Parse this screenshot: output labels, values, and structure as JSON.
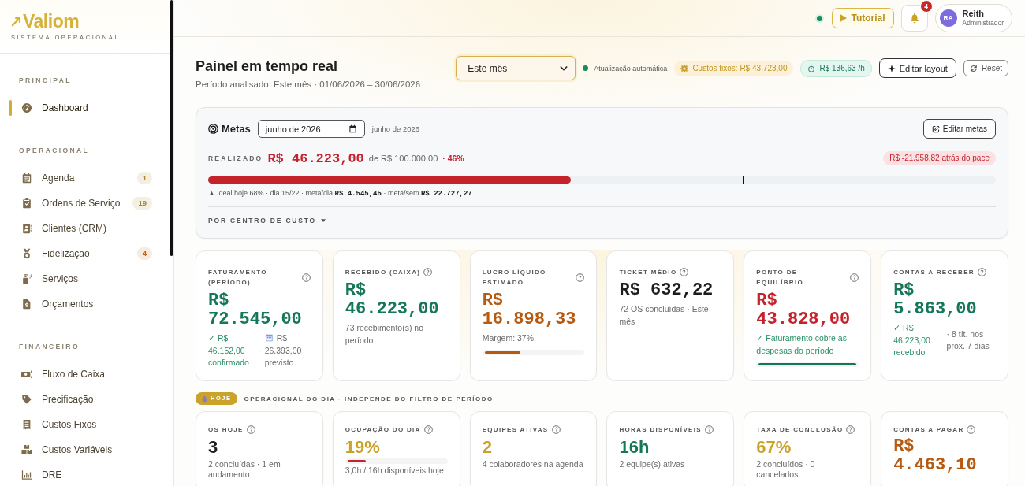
{
  "sidebar": {
    "logo": {
      "name": "Valiom",
      "tagline": "SISTEMA OPERACIONAL"
    },
    "sections": [
      {
        "title": "PRINCIPAL",
        "items": [
          {
            "label": "Dashboard",
            "selected": true
          }
        ]
      },
      {
        "title": "OPERACIONAL",
        "items": [
          {
            "label": "Agenda",
            "selected": false,
            "badge": {
              "text": "1",
              "color": "#a8842a"
            }
          },
          {
            "label": "Ordens de Serviço",
            "selected": false,
            "badge": {
              "text": "19",
              "color": "#a8842a"
            }
          },
          {
            "label": "Clientes (CRM)",
            "selected": false
          },
          {
            "label": "Fidelização",
            "selected": false,
            "badge": {
              "text": "4",
              "color": "#c0621a"
            }
          },
          {
            "label": "Serviços",
            "selected": false
          },
          {
            "label": "Orçamentos",
            "selected": false
          }
        ]
      },
      {
        "title": "FINANCEIRO",
        "items": [
          {
            "label": "Fluxo de Caixa",
            "selected": false
          },
          {
            "label": "Precificação",
            "selected": false
          },
          {
            "label": "Custos Fixos",
            "selected": false
          },
          {
            "label": "Custos Variáveis",
            "selected": false
          },
          {
            "label": "DRE",
            "selected": false
          }
        ]
      }
    ]
  },
  "topbar": {
    "online": true,
    "tutorial_button": "Tutorial",
    "notifications": {
      "count": "4"
    },
    "user": {
      "initials": "RA",
      "name": "Reith",
      "role": "Administrador"
    }
  },
  "header": {
    "title": "Painel em tempo real",
    "subtitle": "Período analisado: Este mês · 01/06/2026 – 30/06/2026",
    "period_select": {
      "value": "Este mês"
    },
    "auto_update": {
      "label": "Atualização automática",
      "on": true
    },
    "chips": [
      {
        "text": "Custos fixos: R$ 43.723,00",
        "kind": "fixed_costs"
      },
      {
        "text": "R$ 136,63 /h",
        "kind": "hourly_rate"
      }
    ],
    "buttons": [
      {
        "label": "Editar layout",
        "kind": "edit_layout"
      },
      {
        "label": "Reset",
        "kind": "reset"
      }
    ]
  },
  "metas": {
    "title": "Metas",
    "month_field": {
      "value": "junho de 2026"
    },
    "month_label": "junho de 2026",
    "edit_button": "Editar metas",
    "realized_label": "REALIZADO",
    "realized_value": "R$ 46.223,00",
    "target": "de R$ 100.000,00",
    "percent": "· 46%",
    "pace_badge": "R$ -21.958,82 atrás do pace",
    "progress": {
      "level": 0.46
    },
    "pace_marker": {
      "level": 0.68
    },
    "note": "▲ ideal hoje 68% · dia 15/22 · meta/dia **R$ 4.545,45** · meta/sem **R$ 22.727,27**",
    "cost_center_toggle": {
      "label": "POR CENTRO DE CUSTO",
      "expanded": false
    }
  },
  "kpis": [
    {
      "label": "FATURAMENTO (PERÍODO)",
      "value": "R$ 72.545,00",
      "kind": "money",
      "color": "#16765a",
      "details": [
        {
          "kind": "split",
          "parts": [
            {
              "text": "✓ R$ 46.152,00 confirmado",
              "kind": "text",
              "color": "#2a8f66"
            },
            {
              "text": "·",
              "kind": "separator"
            },
            {
              "text": "R$ 26.393,00 previsto",
              "kind": "forecast",
              "color": "#6b6b6b"
            }
          ]
        }
      ]
    },
    {
      "label": "RECEBIDO (CAIXA)",
      "value": "R$ 46.223,00",
      "kind": "money",
      "color": "#16765a",
      "details": [
        {
          "kind": "note",
          "text": "73 recebimento(s) no período",
          "color": "#6b6b6b"
        }
      ]
    },
    {
      "label": "LUCRO LÍQUIDO ESTIMADO",
      "value": "R$ 16.898,33",
      "kind": "money",
      "color": "#b65a12",
      "details": [
        {
          "kind": "note",
          "text": "Margem: 37%",
          "color": "#6b6b6b"
        },
        {
          "kind": "bar",
          "level": 0.37,
          "color": "#b65a12"
        }
      ]
    },
    {
      "label": "TICKET MÉDIO",
      "value": "R$ 632,22",
      "kind": "money",
      "color": "#1d1d1d",
      "details": [
        {
          "kind": "note",
          "text": "72 OS concluídas · Este mês",
          "color": "#6b6b6b"
        }
      ]
    },
    {
      "label": "PONTO DE EQUILÍBRIO",
      "value": "R$ 43.828,00",
      "kind": "money",
      "color": "#c4232c",
      "details": [
        {
          "kind": "note",
          "text": "✓ Faturamento cobre as despesas do período",
          "color": "#2a8f66"
        },
        {
          "kind": "bar",
          "level": 1,
          "color": "#16765a"
        }
      ]
    },
    {
      "label": "CONTAS A RECEBER",
      "value": "R$ 5.863,00",
      "kind": "money",
      "color": "#16765a",
      "details": [
        {
          "kind": "split",
          "parts": [
            {
              "text": "✓ R$ 46.223,00 recebido",
              "kind": "text",
              "color": "#2a8f66"
            },
            {
              "text": "· 8 tít. nos próx. 7 dias",
              "kind": "text",
              "color": "#6b6b6b"
            }
          ]
        }
      ]
    }
  ],
  "today": {
    "badge": "HOJE",
    "title": "OPERACIONAL DO DIA · INDEPENDE DO FILTRO DE PERÍODO",
    "cards": [
      {
        "label": "OS HOJE",
        "value": "3",
        "kind": "count",
        "color": "#1d1d1d",
        "details": [
          {
            "kind": "note",
            "text": "2 concluídas · 1 em andamento",
            "color": "#6b6b6b"
          }
        ]
      },
      {
        "label": "OCUPAÇÃO DO DIA",
        "value": "19%",
        "kind": "count",
        "color": "#c9a22b",
        "details": [
          {
            "kind": "bar",
            "level": 0.19,
            "color": "#c4232c"
          },
          {
            "kind": "note",
            "text": "3,0h / 16h disponíveis hoje",
            "color": "#6b6b6b"
          }
        ]
      },
      {
        "label": "EQUIPES ATIVAS",
        "value": "2",
        "kind": "count",
        "color": "#c9a22b",
        "details": [
          {
            "kind": "note",
            "text": "4 colaboradores na agenda",
            "color": "#6b6b6b"
          }
        ]
      },
      {
        "label": "HORAS DISPONÍVEIS",
        "value": "16h",
        "kind": "count",
        "color": "#16765a",
        "details": [
          {
            "kind": "note",
            "text": "2 equipe(s) ativas",
            "color": "#6b6b6b"
          }
        ]
      },
      {
        "label": "TAXA DE CONCLUSÃO",
        "value": "67%",
        "kind": "count",
        "color": "#c9a22b",
        "details": [
          {
            "kind": "note",
            "text": "2 concluídos · 0 cancelados",
            "color": "#6b6b6b"
          }
        ]
      },
      {
        "label": "CONTAS A PAGAR",
        "value": "R$ 4.463,10",
        "kind": "money",
        "color": "#b65a12"
      }
    ]
  }
}
